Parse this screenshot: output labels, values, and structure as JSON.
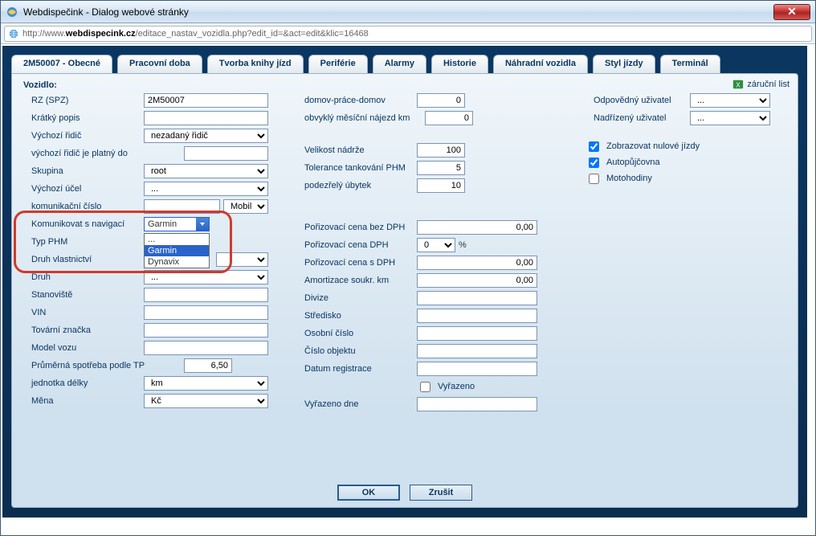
{
  "window": {
    "title": "Webdispečink - Dialog webové stránky",
    "url_prefix": "http://www.",
    "url_bold": "webdispecink.cz",
    "url_rest": "/editace_nastav_vozidla.php?edit_id=&act=edit&klic=16468"
  },
  "tabs": {
    "active": "2M50007 - Obecné",
    "items": [
      "Pracovní doba",
      "Tvorba knihy jízd",
      "Periférie",
      "Alarmy",
      "Historie",
      "Náhradní vozidla",
      "Styl jízdy",
      "Terminál"
    ]
  },
  "link_warranty": "záruční list",
  "section": "Vozidlo:",
  "left": {
    "rz_label": "RZ (SPZ)",
    "rz_value": "2M50007",
    "short_label": "Krátký popis",
    "short_value": "",
    "driver_label": "Výchozí řidič",
    "driver_value": "nezadaný řidič",
    "driver_valid_label": "výchozí řidič je platný do",
    "driver_valid_value": "",
    "group_label": "Skupina",
    "group_value": "root",
    "purpose_label": "Výchozí účel",
    "purpose_value": "...",
    "comm_label": "komunikační číslo",
    "comm_value": "",
    "comm_mode": "Mobil",
    "nav_label": "Komunikovat s navigací",
    "nav_value": "Garmin",
    "nav_options": [
      "...",
      "Garmin",
      "Dynavix"
    ],
    "phm_label": "Typ PHM",
    "owner_label": "Druh vlastnictví",
    "kind_label": "Druh",
    "kind_value": "...",
    "stand_label": "Stanoviště",
    "stand_value": "",
    "vin_label": "VIN",
    "vin_value": "",
    "brand_label": "Tovární značka",
    "brand_value": "",
    "model_label": "Model vozu",
    "model_value": "",
    "consump_label": "Průměrná spotřeba podle TP",
    "consump_value": "6,50",
    "unit_label": "jednotka délky",
    "unit_value": "km",
    "curr_label": "Měna",
    "curr_value": "Kč"
  },
  "mid": {
    "dpd_label": "domov-práce-domov",
    "dpd_value": "0",
    "monthly_label": "obvyklý měsíční nájezd km",
    "monthly_value": "0",
    "tank_label": "Velikost nádrže",
    "tank_value": "100",
    "tol_label": "Tolerance tankování PHM",
    "tol_value": "5",
    "susp_label": "podezřelý úbytek",
    "susp_value": "10",
    "pnv_label": "Pořizovací cena bez DPH",
    "pnv_value": "0,00",
    "dph_label": "Pořizovací cena DPH",
    "dph_sel": "0",
    "dph_unit": "%",
    "pwv_label": "Pořizovací cena s DPH",
    "pwv_value": "0,00",
    "amort_label": "Amortizace soukr. km",
    "amort_value": "0,00",
    "div_label": "Divize",
    "div_value": "",
    "center_label": "Středisko",
    "center_value": "",
    "pnum_label": "Osobní číslo",
    "pnum_value": "",
    "obj_label": "Číslo objektu",
    "obj_value": "",
    "reg_label": "Datum registrace",
    "reg_value": "",
    "retired_chk": "Vyřazeno",
    "retired_date_label": "Vyřazeno dne",
    "retired_date_value": ""
  },
  "right": {
    "resp_label": "Odpovědný uživatel",
    "resp_value": "...",
    "sup_label": "Nadřízený uživatel",
    "sup_value": "...",
    "chk_zero": "Zobrazovat nulové jízdy",
    "chk_rent": "Autopůjčovna",
    "chk_moto": "Motohodiny"
  },
  "buttons": {
    "ok": "OK",
    "cancel": "Zrušit"
  }
}
